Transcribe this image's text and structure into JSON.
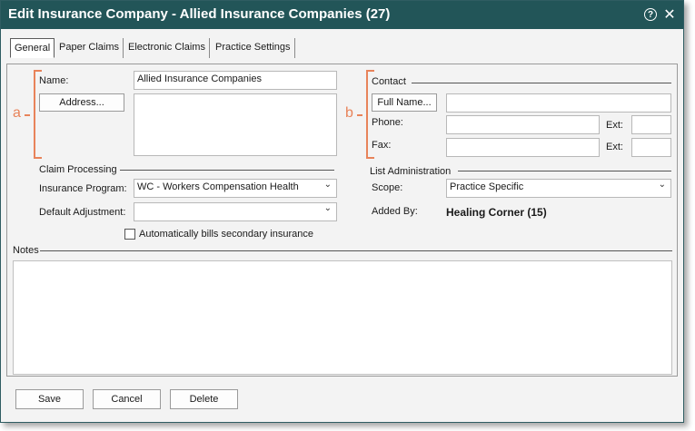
{
  "window": {
    "title": "Edit Insurance Company - Allied Insurance Companies (27)"
  },
  "tabs": [
    {
      "label": "General",
      "active": true
    },
    {
      "label": "Paper Claims"
    },
    {
      "label": "Electronic Claims"
    },
    {
      "label": "Practice Settings"
    }
  ],
  "annotations": {
    "a": "a",
    "b": "b"
  },
  "general": {
    "name_label": "Name:",
    "name_value": "Allied Insurance Companies",
    "address_button": "Address...",
    "address_value": ""
  },
  "contact": {
    "section_label": "Contact",
    "full_name_button": "Full Name...",
    "full_name_value": "",
    "phone_label": "Phone:",
    "phone_value": "",
    "phone_ext_label": "Ext:",
    "phone_ext_value": "",
    "fax_label": "Fax:",
    "fax_value": "",
    "fax_ext_label": "Ext:",
    "fax_ext_value": ""
  },
  "claim_processing": {
    "section_label": "Claim Processing",
    "insurance_program_label": "Insurance Program:",
    "insurance_program_value": "WC - Workers Compensation Health",
    "default_adjustment_label": "Default Adjustment:",
    "default_adjustment_value": "",
    "auto_bill_label": "Automatically bills secondary insurance",
    "auto_bill_checked": false
  },
  "list_admin": {
    "section_label": "List Administration",
    "scope_label": "Scope:",
    "scope_value": "Practice Specific",
    "added_by_label": "Added By:",
    "added_by_value": "Healing Corner (15)"
  },
  "notes": {
    "label": "Notes",
    "value": ""
  },
  "footer": {
    "save_label": "Save",
    "cancel_label": "Cancel",
    "delete_label": "Delete"
  },
  "colors": {
    "titlebar": "#225558",
    "annotation": "#e8835a"
  }
}
